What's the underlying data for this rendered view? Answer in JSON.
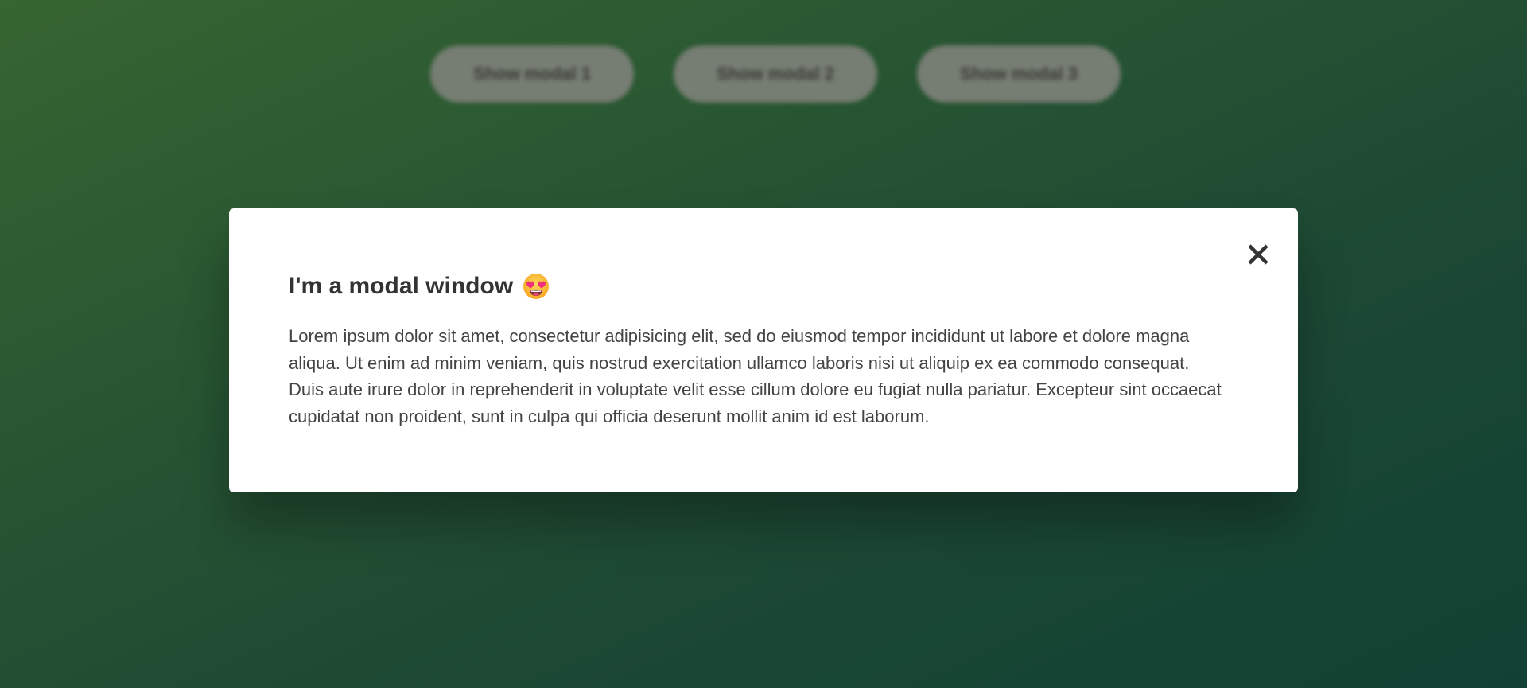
{
  "page": {
    "buttons": [
      {
        "label": "Show modal 1"
      },
      {
        "label": "Show modal 2"
      },
      {
        "label": "Show modal 3"
      }
    ]
  },
  "modal": {
    "close_icon": "close-icon",
    "title": "I'm a modal window",
    "title_emoji": "heart-eyes-emoji-icon",
    "body": "Lorem ipsum dolor sit amet, consectetur adipisicing elit, sed do eiusmod tempor incididunt ut labore et dolore magna aliqua. Ut enim ad minim veniam, quis nostrud exercitation ullamco laboris nisi ut aliquip ex ea commodo consequat. Duis aute irure dolor in reprehenderit in voluptate velit esse cillum dolore eu fugiat nulla pariatur. Excepteur sint occaecat cupidatat non proident, sunt in culpa qui officia deserunt mollit anim id est laborum."
  },
  "colors": {
    "background_start": "#3a6b34",
    "background_end": "#134536",
    "modal_background": "#ffffff",
    "text": "#333333"
  }
}
